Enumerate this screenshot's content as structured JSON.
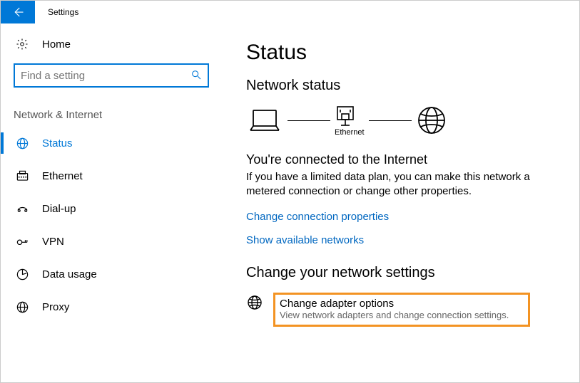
{
  "titlebar": {
    "title": "Settings"
  },
  "sidebar": {
    "home_label": "Home",
    "search_placeholder": "Find a setting",
    "group_name": "Network & Internet",
    "items": [
      {
        "label": "Status"
      },
      {
        "label": "Ethernet"
      },
      {
        "label": "Dial-up"
      },
      {
        "label": "VPN"
      },
      {
        "label": "Data usage"
      },
      {
        "label": "Proxy"
      }
    ]
  },
  "main": {
    "page_title": "Status",
    "status_heading": "Network status",
    "diagram_label": "Ethernet",
    "connected_heading": "You're connected to the Internet",
    "connected_desc": "If you have a limited data plan, you can make this network a metered connection or change other properties.",
    "link_change_props": "Change connection properties",
    "link_show_networks": "Show available networks",
    "change_settings_heading": "Change your network settings",
    "adapter": {
      "title": "Change adapter options",
      "desc": "View network adapters and change connection settings."
    }
  }
}
